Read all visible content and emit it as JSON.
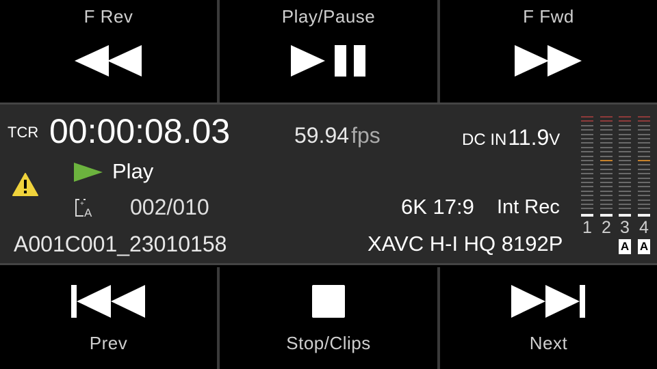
{
  "buttons": {
    "frev": {
      "label": "F Rev"
    },
    "playpause": {
      "label": "Play/Pause"
    },
    "ffwd": {
      "label": "F Fwd"
    },
    "prev": {
      "label": "Prev"
    },
    "stopclips": {
      "label": "Stop/Clips"
    },
    "next": {
      "label": "Next"
    }
  },
  "status": {
    "tc_mode": "TCR",
    "timecode": "00:00:08.03",
    "frame_rate": "59.94",
    "frame_rate_unit": "fps",
    "power_label": "DC IN",
    "power_value": "11.9",
    "power_unit": "V",
    "warning_icon": "warning-triangle-icon",
    "play_state": "Play",
    "clip_counter": "002/010",
    "resolution": "6K 17:9",
    "record_media": "Int Rec",
    "clip_name": "A001C001_23010158",
    "codec": "XAVC H-I HQ 8192P"
  },
  "audio_meters": {
    "channels": [
      {
        "number": "1",
        "auto": false
      },
      {
        "number": "2",
        "auto": false
      },
      {
        "number": "3",
        "auto": true,
        "badge": "A"
      },
      {
        "number": "4",
        "auto": true,
        "badge": "A"
      }
    ]
  },
  "colors": {
    "play_green": "#6cb33e",
    "warning_yellow": "#f0d33c",
    "panel": "#2a2a2a"
  }
}
